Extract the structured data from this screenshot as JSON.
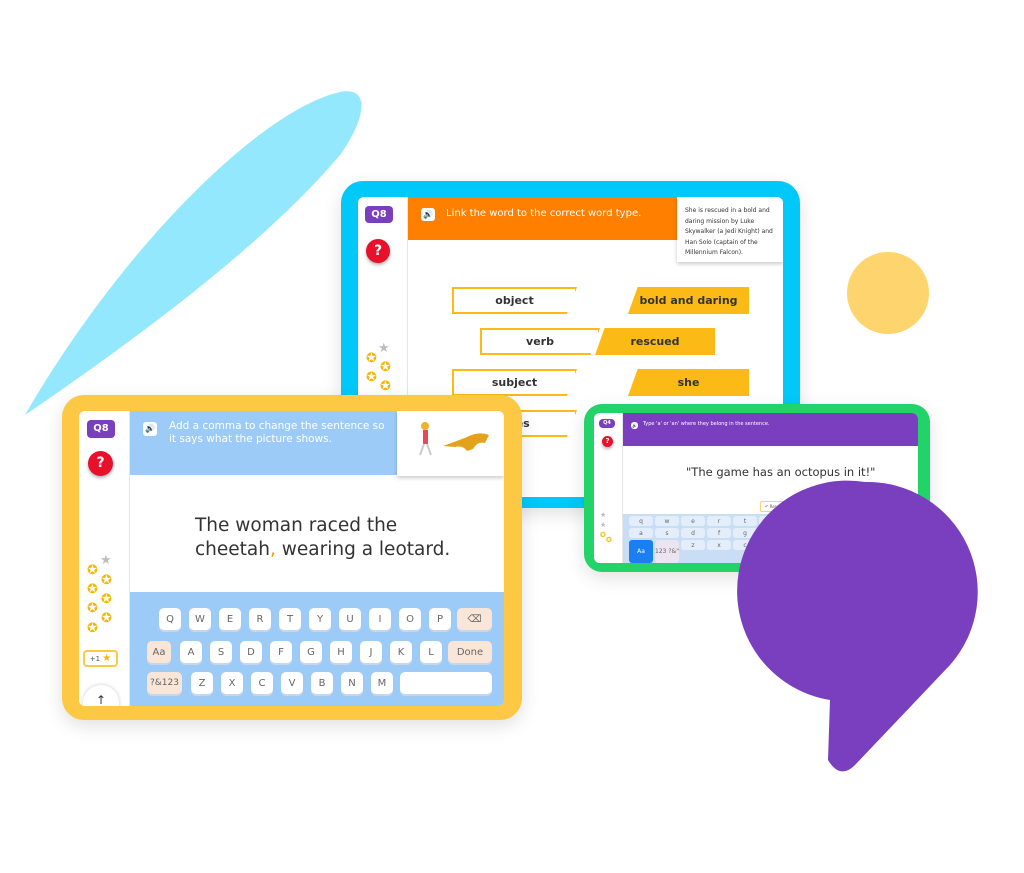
{
  "colors": {
    "cyan_frame": "#00c8f8",
    "yellow_frame": "#fdc843",
    "green_frame": "#22d36a",
    "purple": "#7a3fbf",
    "orange": "#ff7f00",
    "light_blue": "#9ccbf8",
    "swoosh": "#94e8fd",
    "yellow_circle": "#fed46e"
  },
  "tablet_link": {
    "question_badge": "Q8",
    "help_icon": "?",
    "instruction": "Link the word to the correct word type.",
    "sentence": "She is rescued in a bold and daring mission by Luke Skywalker (a Jedi Knight) and Han Solo (captain of the Millennium Falcon).",
    "word_types": [
      "object",
      "verb",
      "subject",
      "…res"
    ],
    "words": [
      "bold and daring",
      "rescued",
      "she"
    ],
    "stars_earned": 5,
    "stars_total": 6
  },
  "tablet_comma": {
    "question_badge": "Q8",
    "help_icon": "?",
    "instruction": "Add a comma to change the sentence so it says what the picture shows.",
    "sentence_part1": "The woman raced the",
    "sentence_part2a": "cheetah",
    "comma": ",",
    "sentence_part2b": " wearing a leotard.",
    "bonus": "+1",
    "keyboard": {
      "row1": [
        "Q",
        "W",
        "E",
        "R",
        "T",
        "Y",
        "U",
        "I",
        "O",
        "P"
      ],
      "row2": [
        "A",
        "S",
        "D",
        "F",
        "G",
        "H",
        "J",
        "K",
        "L"
      ],
      "row3": [
        "Z",
        "X",
        "C",
        "V",
        "B",
        "N",
        "M"
      ],
      "shift": "Aa",
      "done": "Done",
      "symbols": "?&123"
    },
    "stars_earned": 7,
    "stars_total": 8
  },
  "tablet_article": {
    "question_badge": "Q4",
    "help_icon": "?",
    "instruction": "Type 'a' or 'an' where they belong in the sentence.",
    "sentence": "\"The game has an octopus in it!\"",
    "reset": "↶ Reset",
    "keyboard": {
      "row1": [
        "q",
        "w",
        "e",
        "r",
        "t",
        "y"
      ],
      "row2": [
        "a",
        "s",
        "d",
        "f",
        "g",
        "h"
      ],
      "row3": [
        "z",
        "x",
        "c"
      ],
      "shift": "Aa",
      "symbols": "123 ?&\""
    }
  }
}
